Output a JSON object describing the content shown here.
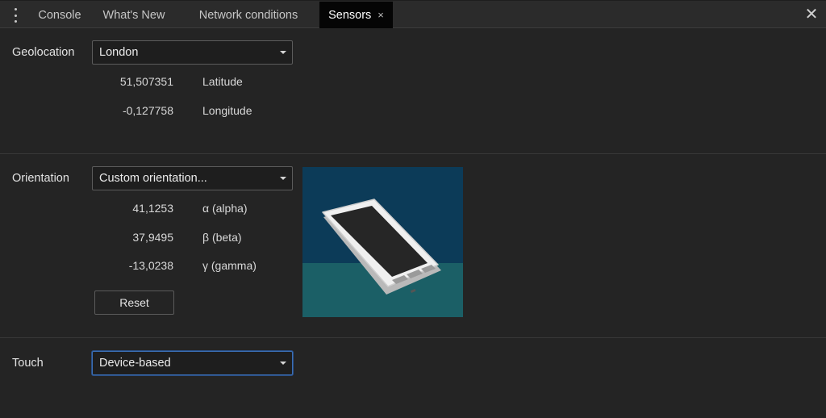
{
  "tabs": [
    {
      "label": "Console"
    },
    {
      "label": "What's New"
    },
    {
      "label": "Network conditions"
    },
    {
      "label": "Sensors",
      "active": true
    }
  ],
  "tab_close_glyph": "×",
  "panel_close_glyph": "✕",
  "geolocation": {
    "label": "Geolocation",
    "selected": "London",
    "latitude": {
      "value": "51,507351",
      "label": "Latitude"
    },
    "longitude": {
      "value": "-0,127758",
      "label": "Longitude"
    }
  },
  "orientation": {
    "label": "Orientation",
    "selected": "Custom orientation...",
    "alpha": {
      "value": "41,1253",
      "label": "α (alpha)"
    },
    "beta": {
      "value": "37,9495",
      "label": "β (beta)"
    },
    "gamma": {
      "value": "-13,0238",
      "label": "γ (gamma)"
    },
    "reset_label": "Reset"
  },
  "touch": {
    "label": "Touch",
    "selected": "Device-based"
  },
  "colors": {
    "background": "#242424",
    "active_tab": "#050505",
    "preview_sky": "#0c3b58",
    "preview_floor": "#1b5f66",
    "focus_border": "#3b6fb6"
  },
  "icons": {
    "menu": "kebab-menu-icon",
    "close": "close-icon",
    "dropdown": "chevron-down-icon"
  }
}
